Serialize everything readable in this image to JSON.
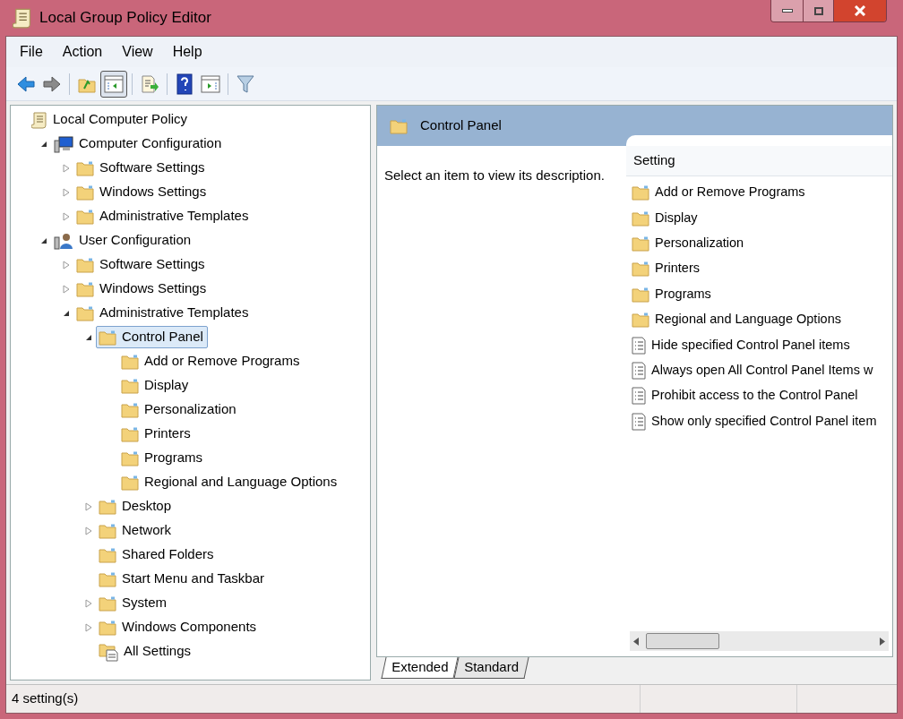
{
  "window": {
    "title": "Local Group Policy Editor"
  },
  "menu": [
    "File",
    "Action",
    "View",
    "Help"
  ],
  "toolbar": [
    {
      "kind": "back",
      "disabled": false
    },
    {
      "kind": "forward",
      "disabled": true
    },
    {
      "kind": "sep"
    },
    {
      "kind": "up"
    },
    {
      "kind": "tree",
      "selected": true
    },
    {
      "kind": "sep"
    },
    {
      "kind": "export"
    },
    {
      "kind": "sep"
    },
    {
      "kind": "help"
    },
    {
      "kind": "pane"
    },
    {
      "kind": "sep"
    },
    {
      "kind": "filter"
    }
  ],
  "tree": [
    {
      "label": "Local Computer Policy",
      "kind": "policy",
      "selected": false,
      "children": [
        {
          "label": "Computer Configuration",
          "kind": "computer",
          "expanded": true,
          "selected": false,
          "children": [
            {
              "label": "Software Settings",
              "kind": "folder",
              "expanded": false,
              "selected": false
            },
            {
              "label": "Windows Settings",
              "kind": "folder",
              "expanded": false,
              "selected": false
            },
            {
              "label": "Administrative Templates",
              "kind": "folder",
              "expanded": false,
              "selected": false
            }
          ]
        },
        {
          "label": "User Configuration",
          "kind": "user",
          "expanded": true,
          "selected": false,
          "children": [
            {
              "label": "Software Settings",
              "kind": "folder",
              "expanded": false,
              "selected": false
            },
            {
              "label": "Windows Settings",
              "kind": "folder",
              "expanded": false,
              "selected": false
            },
            {
              "label": "Administrative Templates",
              "kind": "folder",
              "expanded": true,
              "selected": false,
              "children": [
                {
                  "label": "Control Panel",
                  "kind": "folder",
                  "expanded": true,
                  "selected": true,
                  "children": [
                    {
                      "label": "Add or Remove Programs",
                      "kind": "folder",
                      "selected": false
                    },
                    {
                      "label": "Display",
                      "kind": "folder",
                      "selected": false
                    },
                    {
                      "label": "Personalization",
                      "kind": "folder",
                      "selected": false
                    },
                    {
                      "label": "Printers",
                      "kind": "folder",
                      "selected": false
                    },
                    {
                      "label": "Programs",
                      "kind": "folder",
                      "selected": false
                    },
                    {
                      "label": "Regional and Language Options",
                      "kind": "folder",
                      "selected": false
                    }
                  ]
                },
                {
                  "label": "Desktop",
                  "kind": "folder",
                  "expanded": false,
                  "selected": false
                },
                {
                  "label": "Network",
                  "kind": "folder",
                  "expanded": false,
                  "selected": false
                },
                {
                  "label": "Shared Folders",
                  "kind": "folder",
                  "selected": false
                },
                {
                  "label": "Start Menu and Taskbar",
                  "kind": "folder",
                  "selected": false
                },
                {
                  "label": "System",
                  "kind": "folder",
                  "expanded": false,
                  "selected": false
                },
                {
                  "label": "Windows Components",
                  "kind": "folder",
                  "expanded": false,
                  "selected": false
                },
                {
                  "label": "All Settings",
                  "kind": "allsettings",
                  "selected": false
                }
              ]
            }
          ]
        }
      ]
    }
  ],
  "details": {
    "title": "Control Panel",
    "description": "Select an item to view its description.",
    "column": "Setting",
    "items": [
      {
        "label": "Add or Remove Programs",
        "kind": "folder"
      },
      {
        "label": "Display",
        "kind": "folder"
      },
      {
        "label": "Personalization",
        "kind": "folder"
      },
      {
        "label": "Printers",
        "kind": "folder"
      },
      {
        "label": "Programs",
        "kind": "folder"
      },
      {
        "label": "Regional and Language Options",
        "kind": "folder"
      },
      {
        "label": "Hide specified Control Panel items",
        "kind": "setting"
      },
      {
        "label": "Always open All Control Panel Items w",
        "kind": "setting"
      },
      {
        "label": "Prohibit access to the Control Panel",
        "kind": "setting"
      },
      {
        "label": "Show only specified Control Panel item",
        "kind": "setting"
      }
    ]
  },
  "tabs": [
    {
      "label": "Extended",
      "selected": true
    },
    {
      "label": "Standard",
      "selected": false
    }
  ],
  "status_bar": "4 setting(s)"
}
